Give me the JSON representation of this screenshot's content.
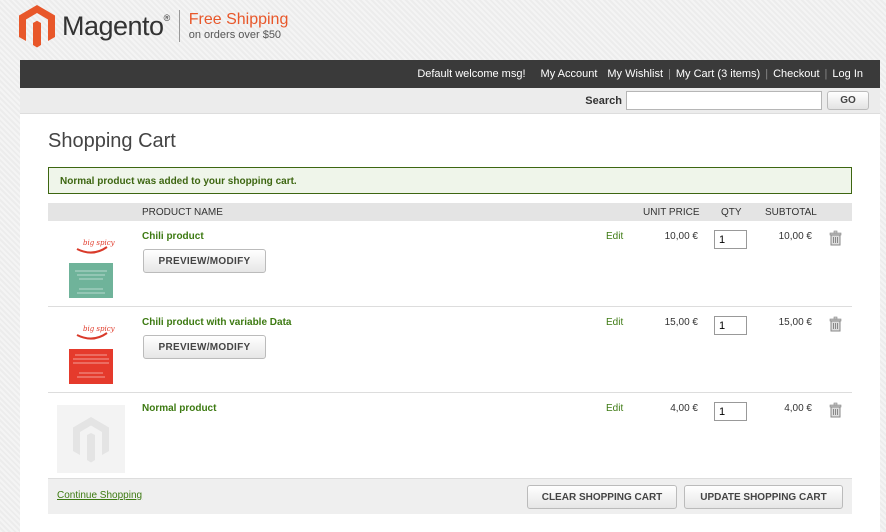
{
  "brand": {
    "name": "Magento",
    "registered": "®",
    "promo_title": "Free Shipping",
    "promo_sub": "on orders over $50",
    "accent": "#e8572a"
  },
  "topbar": {
    "welcome": "Default welcome msg!",
    "links": [
      "My Account",
      "My Wishlist",
      "My Cart (3 items)",
      "Checkout",
      "Log In"
    ]
  },
  "search": {
    "label": "Search",
    "placeholder": "",
    "value": "",
    "button": "GO"
  },
  "page": {
    "title": "Shopping Cart",
    "success_message": "Normal product was added to your shopping cart."
  },
  "cart": {
    "headers": {
      "name": "PRODUCT NAME",
      "unit_price": "UNIT PRICE",
      "qty": "QTY",
      "subtotal": "SUBTOTAL"
    },
    "items": [
      {
        "name": "Chili product",
        "button": "PREVIEW/MODIFY",
        "edit": "Edit",
        "unit_price": "10,00 €",
        "qty": "1",
        "subtotal": "10,00 €",
        "thumb_brand": "big spicy"
      },
      {
        "name": "Chili product with variable Data",
        "button": "PREVIEW/MODIFY",
        "edit": "Edit",
        "unit_price": "15,00 €",
        "qty": "1",
        "subtotal": "15,00 €",
        "thumb_brand": "big spicy"
      },
      {
        "name": "Normal product",
        "edit": "Edit",
        "unit_price": "4,00 €",
        "qty": "1",
        "subtotal": "4,00 €"
      }
    ],
    "footer": {
      "continue": "Continue Shopping",
      "clear": "CLEAR SHOPPING CART",
      "update": "UPDATE SHOPPING CART"
    }
  }
}
